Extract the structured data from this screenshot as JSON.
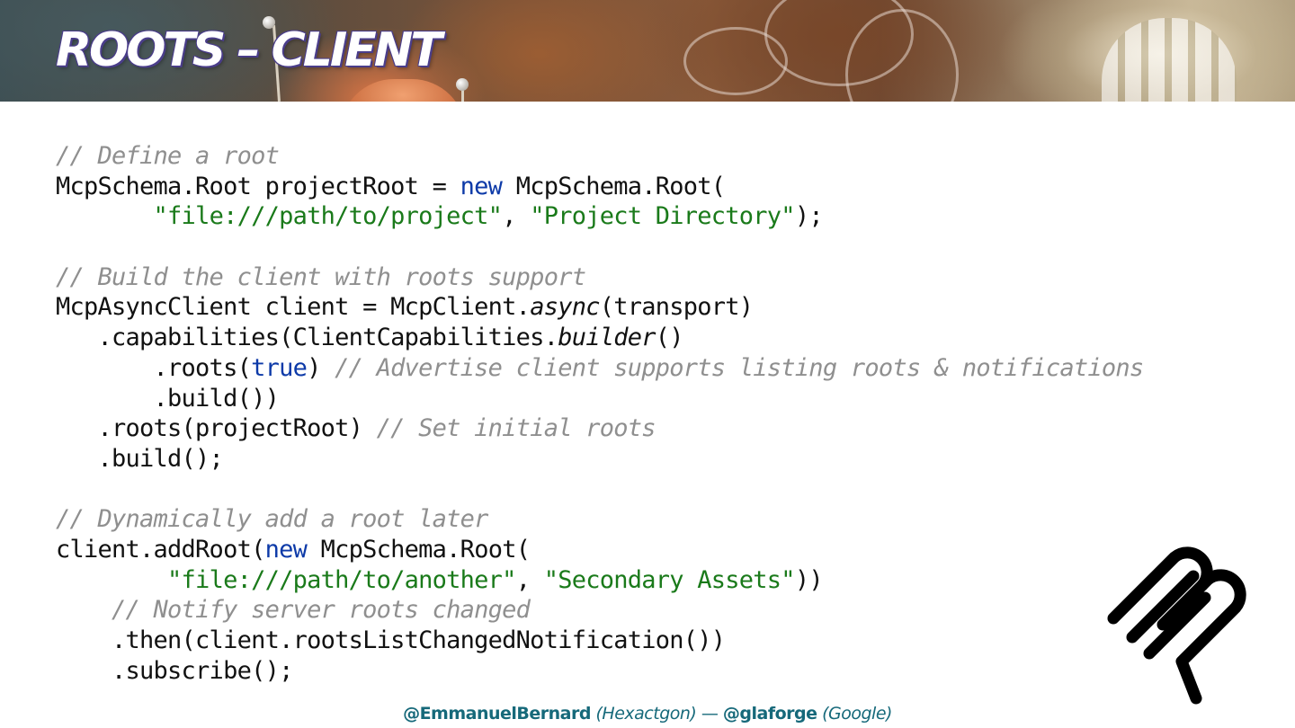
{
  "slide": {
    "title": "Roots – Client"
  },
  "code": {
    "lines": [
      [
        {
          "t": "// Define a root",
          "c": "cm"
        }
      ],
      [
        {
          "t": "McpSchema.Root projectRoot = "
        },
        {
          "t": "new",
          "c": "kw"
        },
        {
          "t": " McpSchema.Root("
        }
      ],
      [
        {
          "t": "       "
        },
        {
          "t": "\"file:///path/to/project\"",
          "c": "st"
        },
        {
          "t": ", "
        },
        {
          "t": "\"Project Directory\"",
          "c": "st"
        },
        {
          "t": ");"
        }
      ],
      [],
      [
        {
          "t": "// Build the client with roots support",
          "c": "cm"
        }
      ],
      [
        {
          "t": "McpAsyncClient client = McpClient."
        },
        {
          "t": "async",
          "c": "it"
        },
        {
          "t": "(transport)"
        }
      ],
      [
        {
          "t": "   .capabilities(ClientCapabilities."
        },
        {
          "t": "builder",
          "c": "it"
        },
        {
          "t": "()"
        }
      ],
      [
        {
          "t": "       .roots("
        },
        {
          "t": "true",
          "c": "kw"
        },
        {
          "t": ") "
        },
        {
          "t": "// Advertise client supports listing roots & notifications",
          "c": "cm"
        }
      ],
      [
        {
          "t": "       .build())"
        }
      ],
      [
        {
          "t": "   .roots(projectRoot) "
        },
        {
          "t": "// Set initial roots",
          "c": "cm"
        }
      ],
      [
        {
          "t": "   .build();"
        }
      ],
      [],
      [
        {
          "t": "// Dynamically add a root later",
          "c": "cm"
        }
      ],
      [
        {
          "t": "client.addRoot("
        },
        {
          "t": "new",
          "c": "kw"
        },
        {
          "t": " McpSchema.Root("
        }
      ],
      [
        {
          "t": "        "
        },
        {
          "t": "\"file:///path/to/another\"",
          "c": "st"
        },
        {
          "t": ", "
        },
        {
          "t": "\"Secondary Assets\"",
          "c": "st"
        },
        {
          "t": "))"
        }
      ],
      [
        {
          "t": "    "
        },
        {
          "t": "// Notify server roots changed",
          "c": "cm"
        }
      ],
      [
        {
          "t": "    .then(client.rootsListChangedNotification())"
        }
      ],
      [
        {
          "t": "    .subscribe();"
        }
      ]
    ]
  },
  "footer": {
    "handle1": "@EmmanuelBernard",
    "org1": "(Hexactgon)",
    "separator": " — ",
    "handle2": "@glaforge",
    "org2": "(Google)"
  },
  "logo": {
    "icon": "mcp-logo-icon",
    "color": "#000000"
  },
  "colors": {
    "keyword": "#0d3aa8",
    "string": "#1a7a1a",
    "comment": "#8f8f8f",
    "footer": "#16697a",
    "title_outline": "#4a3d8a"
  }
}
